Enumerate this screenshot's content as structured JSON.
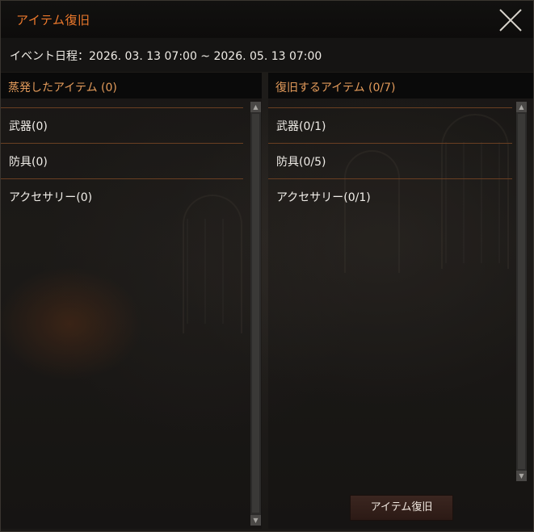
{
  "window": {
    "title": "アイテム復旧",
    "event_schedule": "イベント日程：2026. 03. 13 07:00 ~ 2026. 05. 13 07:00"
  },
  "left_panel": {
    "title": "蒸発したアイテム (0)",
    "items": [
      "武器(0)",
      "防具(0)",
      "アクセサリー(0)"
    ]
  },
  "right_panel": {
    "title": "復旧するアイテム (0/7)",
    "items": [
      "武器(0/1)",
      "防具(0/5)",
      "アクセサリー(0/1)"
    ]
  },
  "actions": {
    "restore_label": "アイテム復旧"
  },
  "icons": {
    "close": "close-icon",
    "scroll_up": "chevron-up-icon",
    "scroll_down": "chevron-down-icon"
  },
  "colors": {
    "title_accent": "#ee7a2c",
    "panel_title": "#e29a5a",
    "divider": "#6a3f22",
    "button_bg": "#3b2620"
  }
}
